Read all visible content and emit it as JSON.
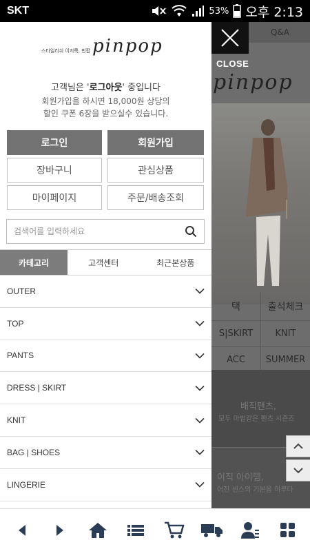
{
  "status_bar": {
    "carrier": "SKT",
    "battery": "53%",
    "time": "오후 2:13"
  },
  "background_page": {
    "top_nav": "Q&A",
    "logo": "pinpop",
    "menu_rows": [
      [
        "택",
        "출석체크"
      ],
      [
        "S|SKIRT",
        "KNIT"
      ],
      [
        "ACC",
        "SUMMER"
      ]
    ],
    "banner1": {
      "title": "배직팬츠,",
      "sub": "모두 마법같은 팬츠 시즌즈"
    },
    "banner2": {
      "title": "이직 아이템,",
      "sub": "어진 센스의 기본을 이루다"
    }
  },
  "close": {
    "label": "CLOSE"
  },
  "drawer": {
    "brand_tagline": "스타일리쉬 이지룩, 핀팝",
    "brand_logo": "pinpop",
    "greeting_prefix": "고객님은 '",
    "greeting_status": "로그아웃",
    "greeting_suffix": "' 중입니다",
    "promo_line1": "회원가입을 하시면 18,000원 상당의",
    "promo_line2": "할인 쿠폰 6장을 받으실수 있습니다.",
    "buttons": {
      "login": "로그인",
      "join": "회원가입",
      "cart": "장바구니",
      "wishlist": "관심상품",
      "mypage": "마이페이지",
      "orders": "주문/배송조회"
    },
    "search": {
      "placeholder": "검색어를 입력하세요",
      "value": ""
    },
    "tabs": [
      "카테고리",
      "고객센터",
      "최근본상품"
    ],
    "categories": [
      "OUTER",
      "TOP",
      "PANTS",
      "DRESS | SKIRT",
      "KNIT",
      "BAG | SHOES",
      "LINGERIE"
    ]
  },
  "nav_icons": [
    "back-icon",
    "forward-icon",
    "home-icon",
    "menu-list-icon",
    "cart-icon",
    "delivery-truck-icon",
    "account-icon",
    "grid-icon"
  ]
}
